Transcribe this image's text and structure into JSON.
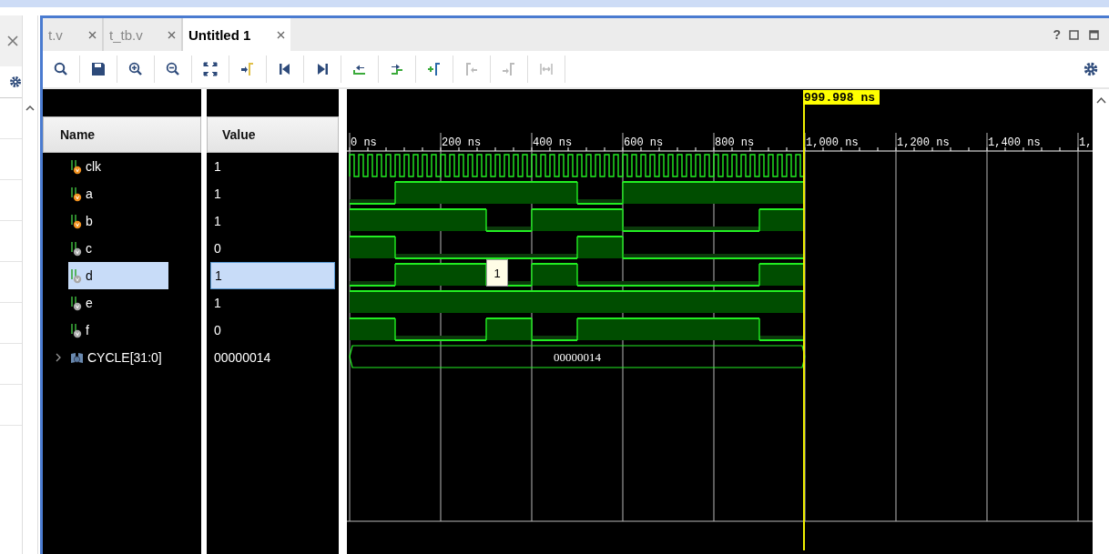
{
  "tabs": [
    {
      "label": "t.v",
      "selected": false
    },
    {
      "label": "t_tb.v",
      "selected": false
    },
    {
      "label": "Untitled 1",
      "selected": true
    }
  ],
  "help_label": "?",
  "columns": {
    "name": "Name",
    "value": "Value"
  },
  "signals": [
    {
      "name": "clk",
      "kind": "clock",
      "port": true,
      "value": "1",
      "selected": false
    },
    {
      "name": "a",
      "kind": "bit",
      "port": true,
      "value": "1",
      "selected": false,
      "wave": [
        false,
        true,
        true,
        true,
        true,
        false,
        true,
        true,
        true,
        true
      ]
    },
    {
      "name": "b",
      "kind": "bit",
      "port": true,
      "value": "1",
      "selected": false,
      "wave": [
        true,
        true,
        true,
        false,
        true,
        true,
        false,
        false,
        false,
        true
      ]
    },
    {
      "name": "c",
      "kind": "bit",
      "port": false,
      "value": "0",
      "selected": false,
      "wave": [
        true,
        false,
        false,
        false,
        false,
        true,
        false,
        false,
        false,
        false
      ]
    },
    {
      "name": "d",
      "kind": "bit",
      "port": false,
      "value": "1",
      "selected": true,
      "wave": [
        false,
        true,
        true,
        false,
        true,
        false,
        false,
        false,
        false,
        true
      ]
    },
    {
      "name": "e",
      "kind": "bit",
      "port": false,
      "value": "1",
      "selected": false,
      "wave": [
        true,
        true,
        true,
        true,
        true,
        true,
        true,
        true,
        true,
        true
      ]
    },
    {
      "name": "f",
      "kind": "bit",
      "port": false,
      "value": "0",
      "selected": false,
      "wave": [
        true,
        false,
        false,
        true,
        false,
        true,
        true,
        true,
        true,
        false
      ]
    },
    {
      "name": "CYCLE[31:0]",
      "kind": "bus",
      "value": "00000014",
      "selected": false,
      "expanded": false,
      "bus_label": "00000014"
    }
  ],
  "ruler_labels": [
    "0 ns",
    "200 ns",
    "400 ns",
    "600 ns",
    "800 ns",
    "1,000 ns",
    "1,200 ns",
    "1,400 ns",
    "1,"
  ],
  "cursor_label": "999.998 ns",
  "tooltip": "1"
}
